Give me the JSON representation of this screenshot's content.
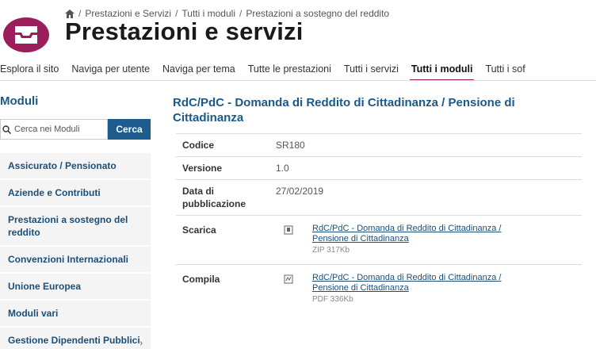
{
  "breadcrumb": {
    "items": [
      "Prestazioni e Servizi",
      "Tutti i moduli",
      "Prestazioni a sostegno del reddito"
    ]
  },
  "header": {
    "title": "Prestazioni e servizi",
    "brand_color": "#9b1d5c"
  },
  "nav": {
    "items": [
      "Esplora il sito",
      "Naviga per utente",
      "Naviga per tema",
      "Tutte le prestazioni",
      "Tutti i servizi",
      "Tutti i moduli",
      "Tutti i sof"
    ],
    "active": "Tutti i moduli"
  },
  "sidebar": {
    "title": "Moduli",
    "search": {
      "placeholder": "Cerca nei Moduli",
      "button": "Cerca"
    },
    "items": [
      {
        "label": "Assicurato / Pensionato"
      },
      {
        "label": "Aziende e Contributi"
      },
      {
        "label": "Prestazioni a sostegno del reddito"
      },
      {
        "label": "Convenzioni Internazionali"
      },
      {
        "label": "Unione Europea"
      },
      {
        "label": "Moduli vari"
      },
      {
        "label": "Gestione Dipendenti Pubblici"
      }
    ]
  },
  "module": {
    "title": "RdC/PdC - Domanda di Reddito di Cittadinanza / Pensione di Cittadinanza",
    "codice_label": "Codice",
    "codice": "SR180",
    "versione_label": "Versione",
    "versione": "1.0",
    "data_label": "Data di pubblicazione",
    "data": "27/02/2019",
    "scarica": {
      "label": "Scarica",
      "link": "RdC/PdC - Domanda di Reddito di Cittadinanza / Pensione di Cittadinanza",
      "meta": "ZIP 317Kb"
    },
    "compila": {
      "label": "Compila",
      "link": "RdC/PdC - Domanda di Reddito di Cittadinanza / Pensione di Cittadinanza",
      "meta": "PDF 336Kb"
    }
  }
}
